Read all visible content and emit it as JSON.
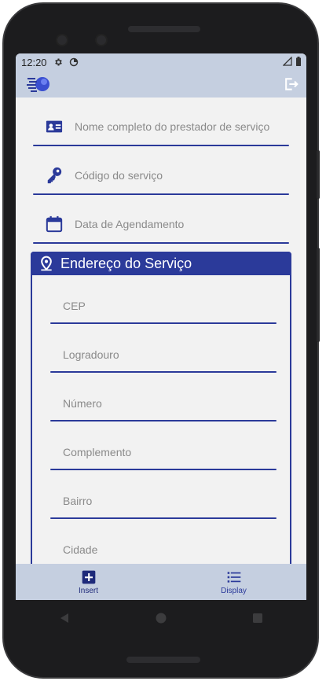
{
  "status_bar": {
    "time": "12:20",
    "icons": [
      "settings-icon",
      "data-saver-icon",
      "signal-icon",
      "battery-icon"
    ]
  },
  "app_bar": {
    "logo_icon": "app-logo-icon",
    "logout_icon": "logout-icon"
  },
  "form": {
    "fields": [
      {
        "icon": "id-card-icon",
        "placeholder": "Nome completo do prestador de serviço"
      },
      {
        "icon": "key-icon",
        "placeholder": "Código do serviço"
      },
      {
        "icon": "calendar-icon",
        "placeholder": "Data de Agendamento"
      }
    ],
    "address": {
      "title": "Endereço do Serviço",
      "icon": "location-pin-icon",
      "fields": [
        {
          "placeholder": "CEP"
        },
        {
          "placeholder": "Logradouro"
        },
        {
          "placeholder": "Número"
        },
        {
          "placeholder": "Complemento"
        },
        {
          "placeholder": "Bairro"
        },
        {
          "placeholder": "Cidade"
        }
      ]
    }
  },
  "bottom_nav": {
    "items": [
      {
        "label": "Insert",
        "icon": "add-box-icon",
        "active": true
      },
      {
        "label": "Display",
        "icon": "list-icon",
        "active": false
      }
    ]
  },
  "system_nav": {
    "buttons": [
      "back-icon",
      "home-icon",
      "recents-icon"
    ]
  },
  "colors": {
    "primary": "#2b3a9a",
    "app_bar": "#c5cfe0",
    "background": "#f2f2f2",
    "placeholder": "#8a8a8a"
  }
}
